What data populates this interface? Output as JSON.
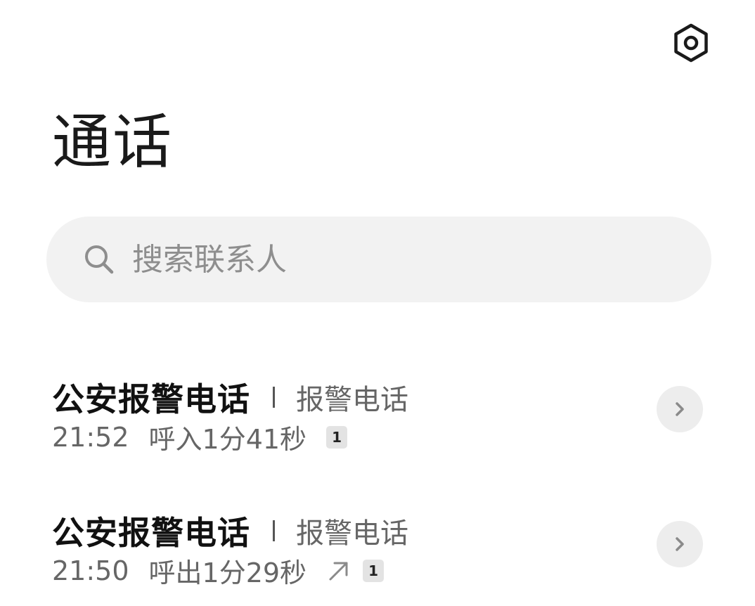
{
  "header": {
    "settings_icon": "settings-hexagon-icon",
    "title": "通话"
  },
  "search": {
    "icon": "search-icon",
    "placeholder": "搜索联系人",
    "value": ""
  },
  "calls": [
    {
      "name": "公安报警电话",
      "tag": "报警电话",
      "time": "21:52",
      "description": "呼入1分41秒",
      "direction": "incoming",
      "sim": "1",
      "detail_icon": "chevron-right-icon"
    },
    {
      "name": "公安报警电话",
      "tag": "报警电话",
      "time": "21:50",
      "description": "呼出1分29秒",
      "direction": "outgoing",
      "direction_icon": "outgoing-arrow-icon",
      "sim": "1",
      "detail_icon": "chevron-right-icon"
    }
  ],
  "colors": {
    "background": "#ffffff",
    "search_bg": "#f2f2f2",
    "primary_text": "#111111",
    "secondary_text": "#666666",
    "detail_button_bg": "#ededed"
  }
}
